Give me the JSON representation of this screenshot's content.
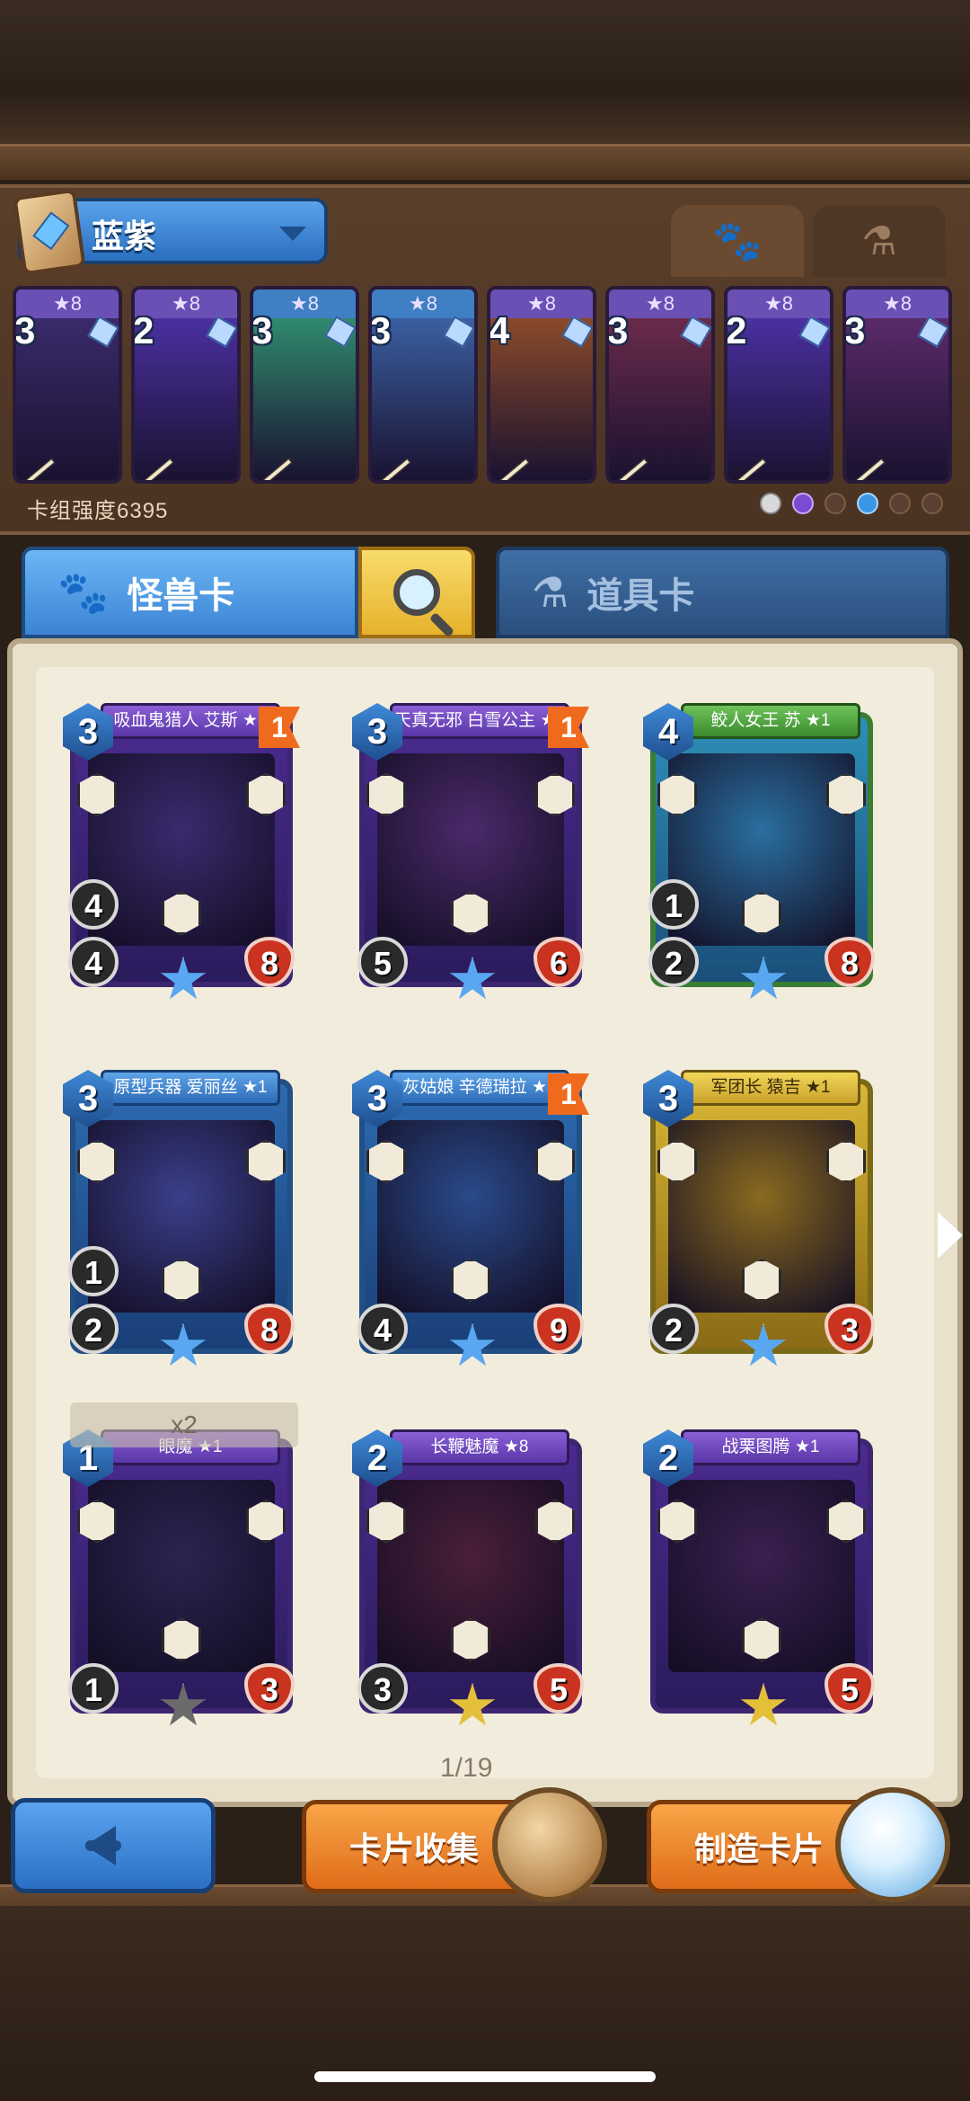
{
  "deck": {
    "name": "蓝紫",
    "power_label": "卡组强度6395",
    "filters": [
      {
        "icon": "paw-icon",
        "active": true
      },
      {
        "icon": "potion-icon",
        "active": false
      }
    ],
    "mini_cards": [
      {
        "cost": "3",
        "stars": "★8",
        "color": "purple"
      },
      {
        "cost": "2",
        "stars": "★8",
        "color": "purple"
      },
      {
        "cost": "3",
        "stars": "★8",
        "color": "blue"
      },
      {
        "cost": "3",
        "stars": "★8",
        "color": "blue"
      },
      {
        "cost": "4",
        "stars": "★8",
        "color": "purple"
      },
      {
        "cost": "3",
        "stars": "★8",
        "color": "purple"
      },
      {
        "cost": "2",
        "stars": "★8",
        "color": "purple"
      },
      {
        "cost": "3",
        "stars": "★8",
        "color": "purple"
      }
    ]
  },
  "tabs": {
    "monster": "怪兽卡",
    "item": "道具卡"
  },
  "cards": [
    {
      "name": "吸血鬼猎人 艾斯 ★8",
      "cost": "3",
      "flag": "1",
      "spd": "4",
      "atk": "4",
      "hp": "8",
      "frame": "purple",
      "banner": "",
      "art": "#3a2b6e"
    },
    {
      "name": "天真无邪 白雪公主 ★8",
      "cost": "3",
      "flag": "1",
      "spd": "",
      "atk": "5",
      "hp": "6",
      "frame": "purple",
      "banner": "",
      "art": "#4a2a6a"
    },
    {
      "name": "鲛人女王 苏 ★1",
      "cost": "4",
      "flag": "",
      "spd": "1",
      "atk": "2",
      "hp": "8",
      "frame": "green",
      "banner": "gr",
      "art": "#2a6fa0"
    },
    {
      "name": "原型兵器 爱丽丝 ★1",
      "cost": "3",
      "flag": "",
      "spd": "1",
      "atk": "2",
      "hp": "8",
      "frame": "blue",
      "banner": "bl",
      "art": "#3a3f8a"
    },
    {
      "name": "灰姑娘 辛德瑞拉 ★8",
      "cost": "3",
      "flag": "1",
      "spd": "",
      "atk": "4",
      "hp": "9",
      "frame": "blue",
      "banner": "bl",
      "art": "#2a4a8a"
    },
    {
      "name": "军团长 猿吉 ★1",
      "cost": "3",
      "flag": "",
      "spd": "",
      "atk": "2",
      "hp": "3",
      "frame": "gold",
      "banner": "yl",
      "art": "#8a6a20"
    },
    {
      "name": "眼魔 ★1",
      "cost": "1",
      "flag": "",
      "spd": "",
      "atk": "1",
      "hp": "3",
      "frame": "purple",
      "banner": "",
      "art": "#2a2550"
    },
    {
      "name": "长鞭魅魔 ★8",
      "cost": "2",
      "flag": "",
      "spd": "",
      "atk": "3",
      "hp": "5",
      "frame": "purple",
      "banner": "",
      "art": "#4a1f3a"
    },
    {
      "name": "战栗图腾 ★1",
      "cost": "2",
      "flag": "",
      "spd": "",
      "atk": "",
      "hp": "5",
      "frame": "purple",
      "banner": "",
      "art": "#3a2050"
    }
  ],
  "x2_label": "x2",
  "page_indicator": "1/19",
  "buttons": {
    "collect": "卡片收集",
    "craft": "制造卡片"
  }
}
